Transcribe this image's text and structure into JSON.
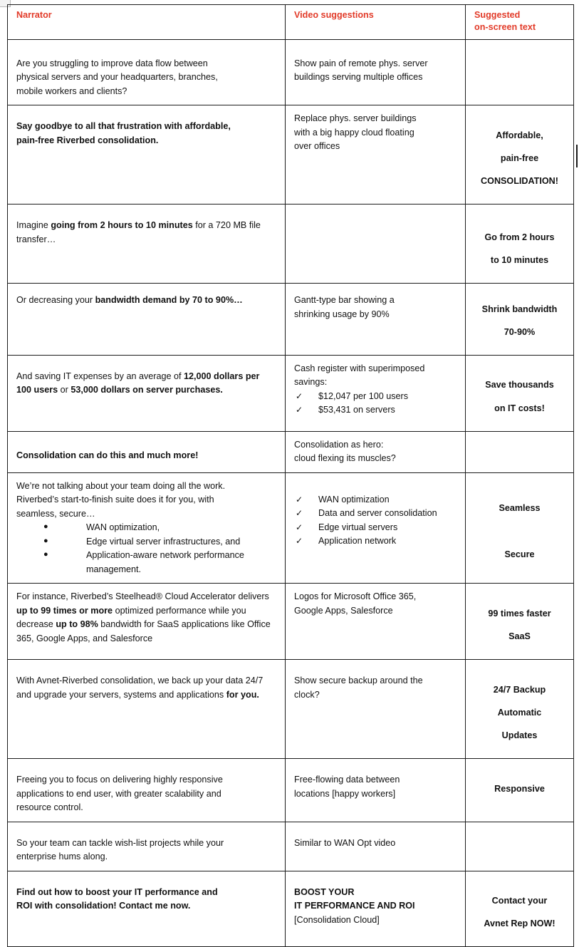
{
  "document": {
    "type": "video-script-storyboard-table",
    "accent_color": "#e23b29",
    "border_color": "#1c1c1c"
  },
  "table": {
    "headers": {
      "narrator": "Narrator",
      "video": "Video suggestions",
      "onscreen_line1": "Suggested",
      "onscreen_line2": "on-screen text"
    },
    "rows": [
      {
        "narrator": {
          "lines": [
            "Are you struggling to improve data flow between",
            "physical servers and your headquarters, branches,",
            "mobile workers and clients?"
          ]
        },
        "video": {
          "lines": [
            "Show pain of remote phys. server",
            "buildings serving multiple offices"
          ]
        },
        "onscreen": {
          "lines": []
        }
      },
      {
        "narrator": {
          "bold_lines": [
            "Say goodbye to all that frustration with affordable,",
            "pain-free Riverbed consolidation."
          ]
        },
        "video": {
          "lines": [
            "Replace phys. server buildings",
            "with a big happy cloud floating",
            "over offices"
          ]
        },
        "onscreen": {
          "lines": [
            "Affordable,",
            "pain-free",
            "CONSOLIDATION!"
          ]
        }
      },
      {
        "narrator": {
          "segments": [
            {
              "text": "Imagine ",
              "bold": false
            },
            {
              "text": "going from 2 hours to 10 minutes",
              "bold": true
            },
            {
              "text": " for a 720 MB file transfer…",
              "bold": false
            }
          ]
        },
        "video": {
          "lines": []
        },
        "onscreen": {
          "lines": [
            "Go from 2 hours",
            "to 10 minutes"
          ]
        }
      },
      {
        "narrator": {
          "segments": [
            {
              "text": "Or decreasing your ",
              "bold": false
            },
            {
              "text": "bandwidth demand by 70 to 90%…",
              "bold": true
            }
          ]
        },
        "video": {
          "lines": [
            "Gantt-type bar showing a",
            "shrinking usage by 90%"
          ]
        },
        "onscreen": {
          "lines": [
            "Shrink bandwidth",
            "70-90%"
          ]
        }
      },
      {
        "narrator": {
          "segments": [
            {
              "text": "And saving IT expenses by an average of ",
              "bold": false
            },
            {
              "text": "12,000 dollars per 100 users",
              "bold": true
            },
            {
              "text": " or ",
              "bold": false
            },
            {
              "text": "53,000 dollars on server purchases.",
              "bold": true
            }
          ]
        },
        "video": {
          "lines": [
            "Cash register with superimposed",
            "savings:"
          ],
          "checklist": [
            "$12,047 per 100 users",
            "$53,431 on servers"
          ]
        },
        "onscreen": {
          "lines": [
            "Save thousands",
            "on IT costs!"
          ]
        }
      },
      {
        "narrator": {
          "bold_lines": [
            "Consolidation can do this and much more!"
          ]
        },
        "video": {
          "lines": [
            "Consolidation as hero:",
            "cloud flexing its muscles?"
          ]
        },
        "onscreen": {
          "lines": []
        }
      },
      {
        "narrator": {
          "lines": [
            "We’re not talking about your team doing all the work.",
            "Riverbed’s start-to-finish suite does it for you, with",
            "seamless, secure…"
          ],
          "bullets": [
            "WAN optimization,",
            "Edge virtual server infrastructures, and",
            "Application-aware network performance management."
          ]
        },
        "video": {
          "checklist": [
            "WAN optimization",
            "Data and server consolidation",
            "Edge virtual servers",
            "Application network"
          ]
        },
        "onscreen": {
          "lines": [
            "Seamless",
            "",
            "Secure"
          ]
        }
      },
      {
        "narrator": {
          "segments": [
            {
              "text": "For instance, Riverbed’s Steelhead® Cloud Accelerator delivers ",
              "bold": false
            },
            {
              "text": "up to 99 times or more",
              "bold": true
            },
            {
              "text": " optimized performance while you decrease ",
              "bold": false
            },
            {
              "text": "up to 98%",
              "bold": true
            },
            {
              "text": " bandwidth for SaaS applications like Office 365, Google Apps, and Salesforce",
              "bold": false
            }
          ]
        },
        "video": {
          "lines": [
            "Logos for Microsoft Office 365,",
            "Google Apps, Salesforce"
          ]
        },
        "onscreen": {
          "lines": [
            "99 times faster",
            "SaaS"
          ]
        }
      },
      {
        "narrator": {
          "segments": [
            {
              "text": "With Avnet-Riverbed consolidation, we back up your data 24/7 and upgrade your servers, systems and applications ",
              "bold": false
            },
            {
              "text": "for you.",
              "bold": true
            }
          ]
        },
        "video": {
          "lines": [
            "Show secure backup around the",
            "clock?"
          ]
        },
        "onscreen": {
          "lines": [
            "24/7 Backup",
            "Automatic",
            "Updates"
          ]
        }
      },
      {
        "narrator": {
          "lines": [
            "Freeing you to focus on delivering highly responsive",
            "applications to end user, with greater scalability and",
            "resource control."
          ]
        },
        "video": {
          "lines": [
            "Free-flowing data between",
            "locations [happy workers]"
          ]
        },
        "onscreen": {
          "lines": [
            "Responsive"
          ]
        }
      },
      {
        "narrator": {
          "lines": [
            "So your team can tackle wish-list projects while your",
            "enterprise hums along."
          ]
        },
        "video": {
          "lines": [
            "Similar to WAN Opt video"
          ]
        },
        "onscreen": {
          "lines": []
        }
      },
      {
        "narrator": {
          "bold_lines": [
            "Find out how to boost your IT performance and",
            "ROI with consolidation! Contact me now."
          ]
        },
        "video": {
          "bold_lines": [
            "BOOST YOUR",
            "IT PERFORMANCE AND ROI"
          ],
          "lines": [
            "[Consolidation Cloud]"
          ]
        },
        "onscreen": {
          "lines": [
            "Contact your",
            "Avnet Rep NOW!"
          ]
        }
      }
    ]
  },
  "icons": {
    "check": "✓",
    "bullet": "●"
  }
}
